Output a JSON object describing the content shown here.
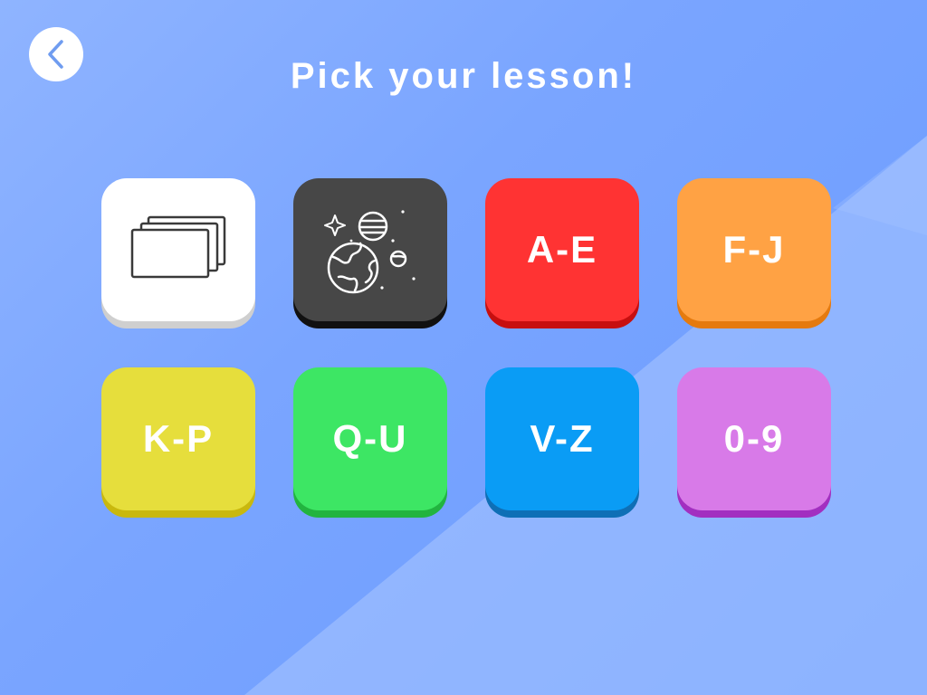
{
  "header": {
    "title": "Pick your lesson!"
  },
  "back_button": {
    "icon": "chevron-left-icon"
  },
  "lessons": [
    {
      "id": "flashcards",
      "label": "",
      "icon": "flashcards-icon",
      "color": "#ffffff",
      "shadow": "#cfcfcf"
    },
    {
      "id": "space",
      "label": "",
      "icon": "planets-icon",
      "color": "#474747",
      "shadow": "#111111"
    },
    {
      "id": "a-e",
      "label": "A-E",
      "color": "#ff3333",
      "shadow": "#c70f0f"
    },
    {
      "id": "f-j",
      "label": "F-J",
      "color": "#ffa244",
      "shadow": "#e57a0e"
    },
    {
      "id": "k-p",
      "label": "K-P",
      "color": "#e6de3c",
      "shadow": "#c9b80e"
    },
    {
      "id": "q-u",
      "label": "Q-U",
      "color": "#3de664",
      "shadow": "#22b43f"
    },
    {
      "id": "v-z",
      "label": "V-Z",
      "color": "#0a9cf5",
      "shadow": "#0e6fb6"
    },
    {
      "id": "0-9",
      "label": "0-9",
      "color": "#d87ae8",
      "shadow": "#a22fc0"
    }
  ],
  "colors": {
    "background": "#7aa5ff",
    "accent_back_icon": "#6f9cf0"
  }
}
